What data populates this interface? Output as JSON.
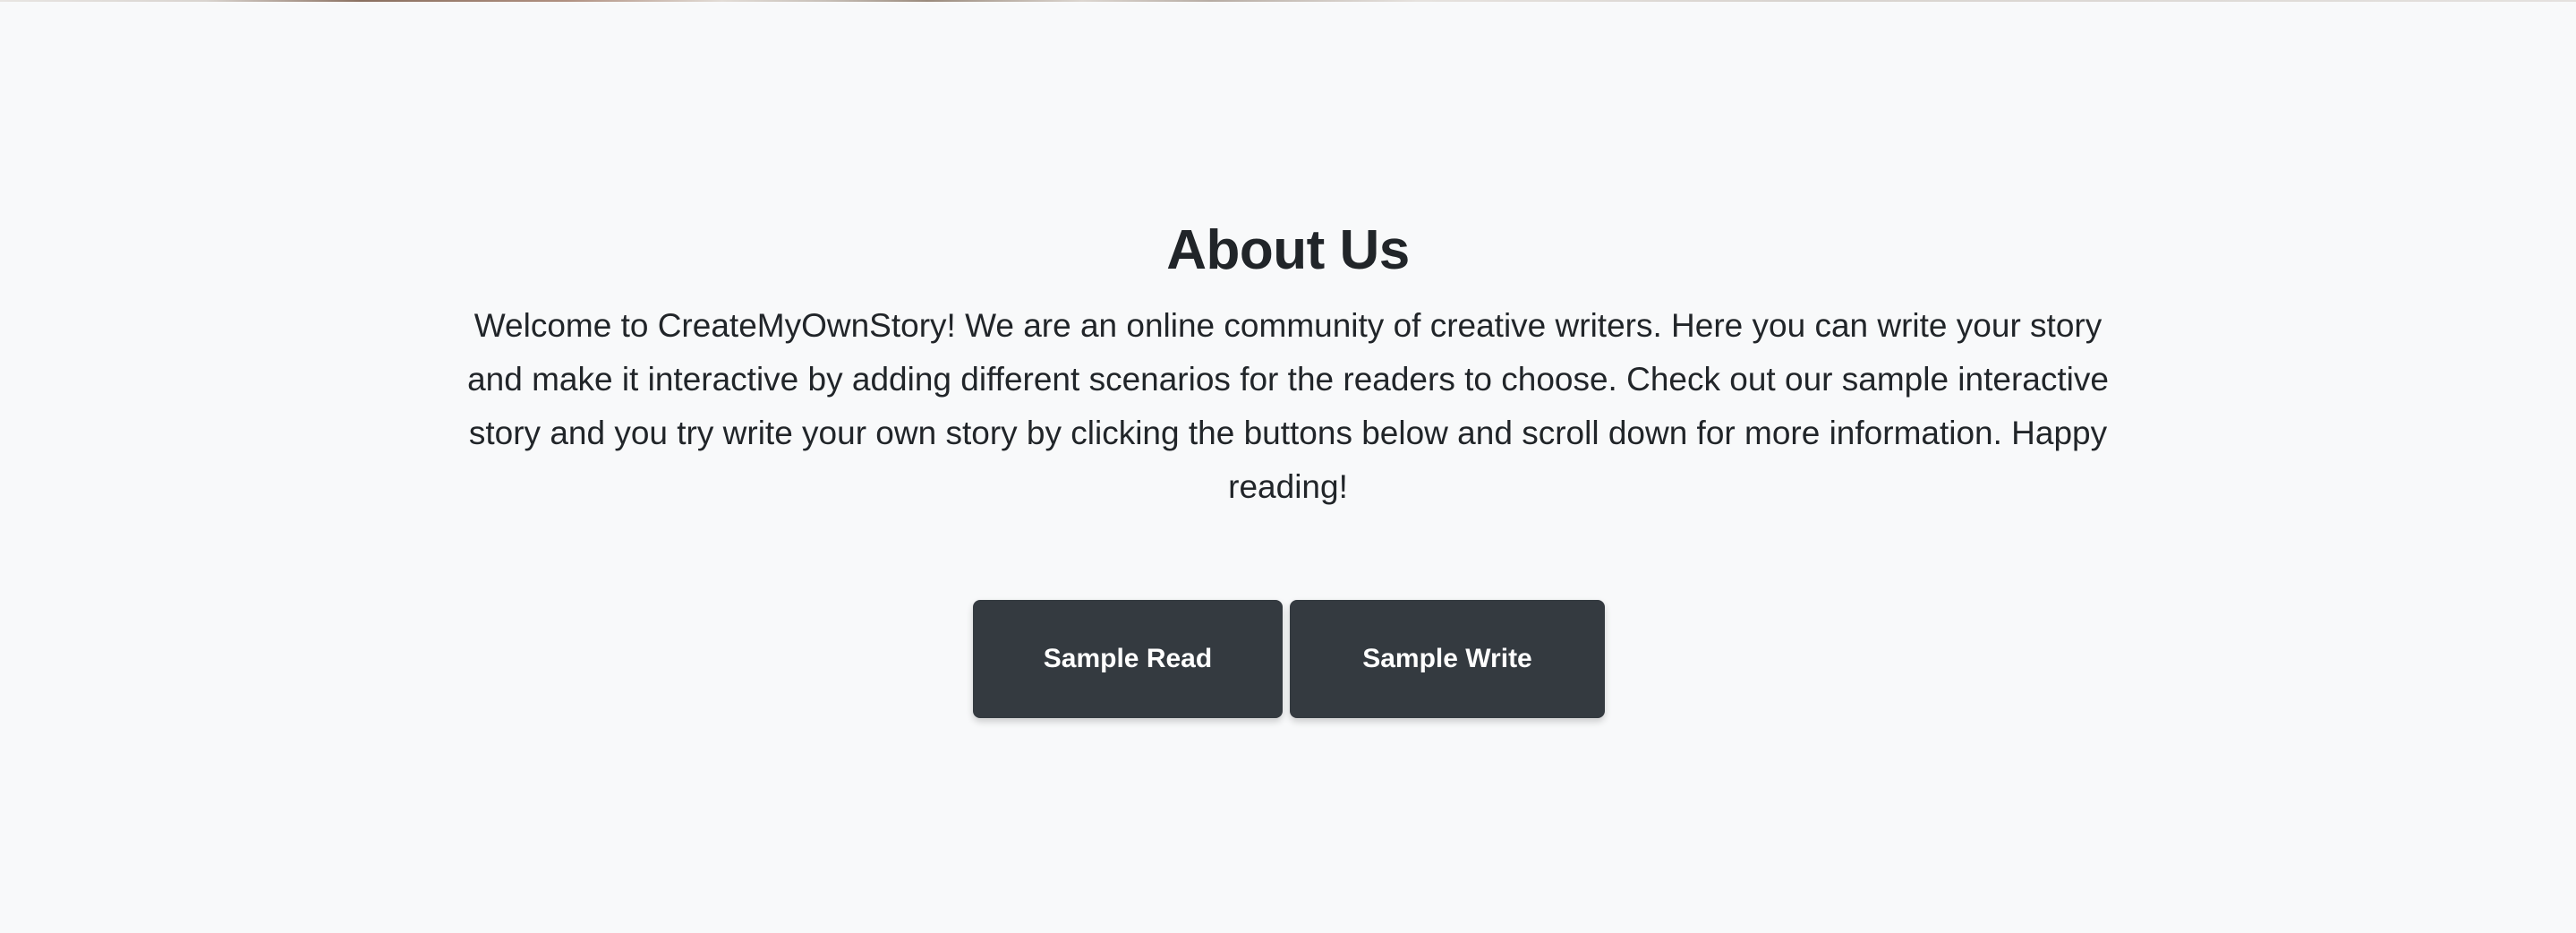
{
  "about": {
    "title": "About Us",
    "text": "Welcome to CreateMyOwnStory! We are an online community of creative writers. Here you can write your story and make it interactive by adding different scenarios for the readers to choose. Check out our sample interactive story and you try write your own story by clicking the buttons below and scroll down for more information. Happy reading!",
    "buttons": {
      "read_label": "Sample Read",
      "write_label": "Sample Write"
    }
  },
  "colors": {
    "background": "#f8f9fa",
    "button_bg": "#343a40",
    "button_text": "#ffffff",
    "text": "#212529"
  }
}
